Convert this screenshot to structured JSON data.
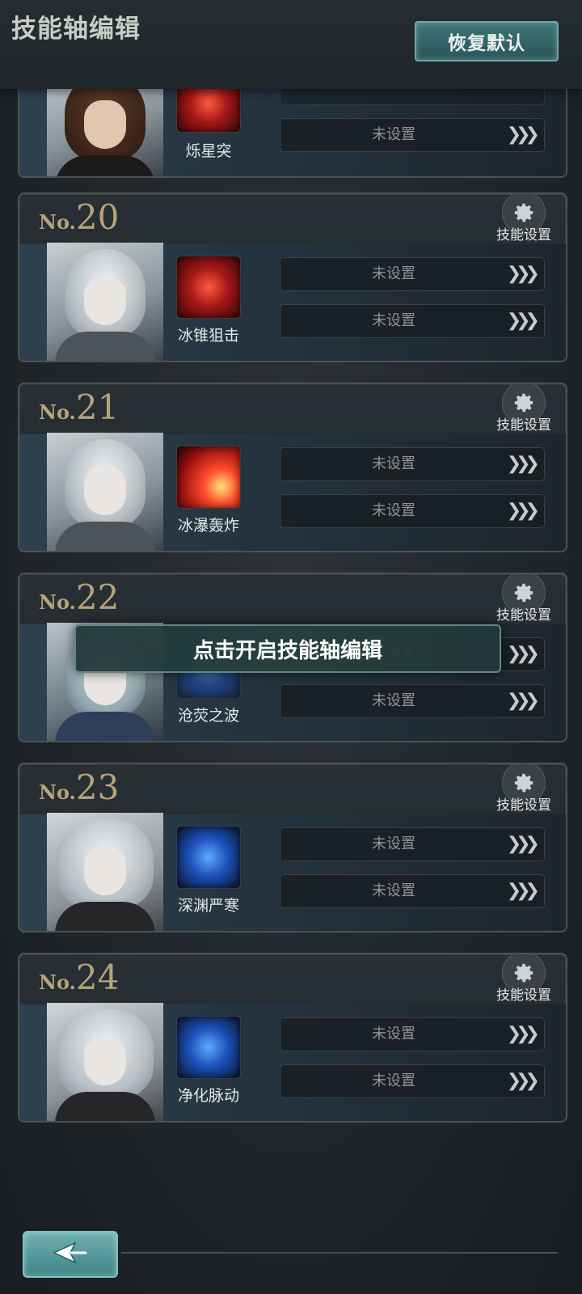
{
  "header": {
    "title": "技能轴编辑",
    "reset_label": "恢复默认"
  },
  "toast": "点击开启技能轴编辑",
  "common": {
    "settings_label": "技能设置",
    "unset_label": "未设置",
    "chevron": "❯❯❯",
    "no_prefix": "No."
  },
  "cards": [
    {
      "num": "",
      "skill": "烁星突"
    },
    {
      "num": "20",
      "skill": "冰锥狙击"
    },
    {
      "num": "21",
      "skill": "冰瀑轰炸"
    },
    {
      "num": "22",
      "skill": "沧荧之波"
    },
    {
      "num": "23",
      "skill": "深渊严寒"
    },
    {
      "num": "24",
      "skill": "净化脉动"
    }
  ],
  "colors": {
    "accent_teal": "#3e7376",
    "number_gold": "#b6a47a",
    "bg": "#1f2529"
  },
  "icons": [
    "gear-icon",
    "back-arrow-icon",
    "chevron-right-icon"
  ]
}
